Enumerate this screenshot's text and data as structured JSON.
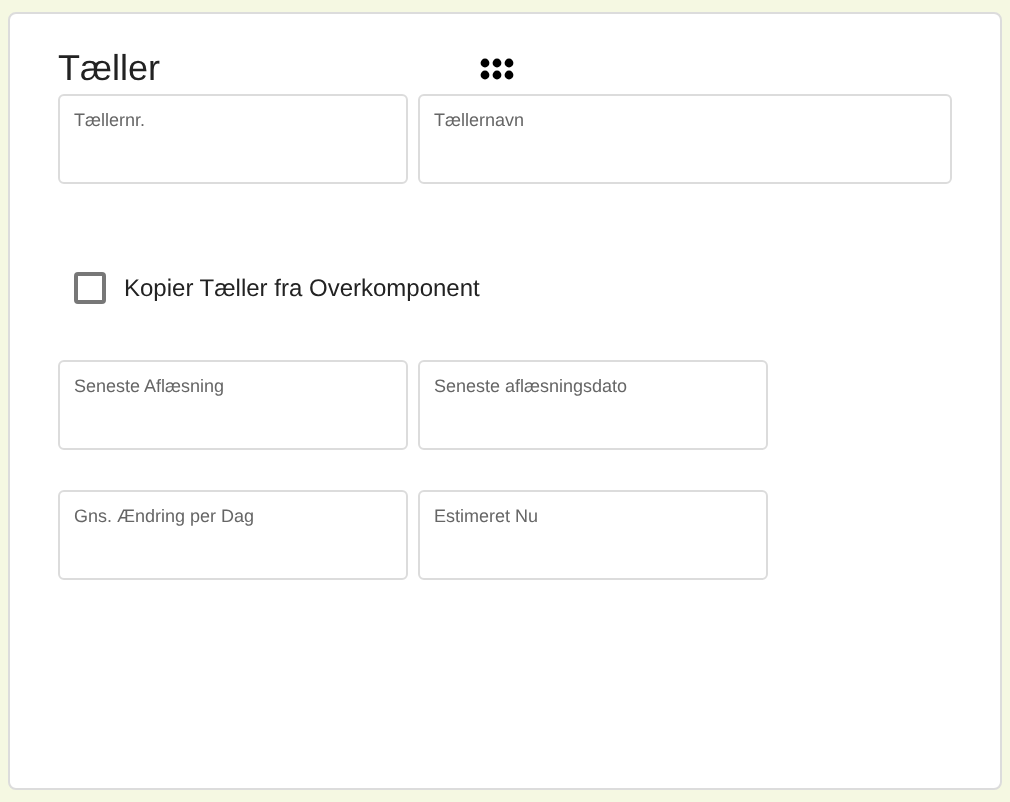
{
  "title": "Tæller",
  "field_rows": [
    {
      "fields": [
        {
          "label": "Tællernr.",
          "wide": false
        },
        {
          "label": "Tællernavn",
          "wide": true
        }
      ]
    },
    {
      "fields": [
        {
          "label": "Seneste Aflæsning",
          "wide": false
        },
        {
          "label": "Seneste aflæsningsdato",
          "wide": false
        }
      ]
    },
    {
      "fields": [
        {
          "label": "Gns. Ændring per Dag",
          "wide": false
        },
        {
          "label": "Estimeret Nu",
          "wide": false
        }
      ]
    }
  ],
  "checkbox": {
    "label": "Kopier Tæller fra Overkomponent",
    "checked": false
  }
}
